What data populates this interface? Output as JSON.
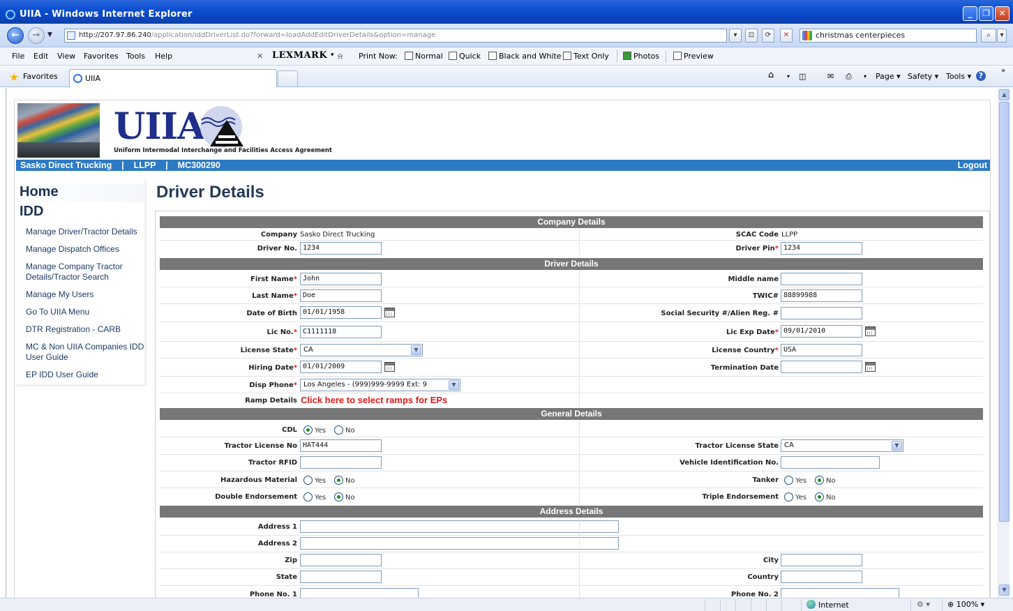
{
  "window": {
    "title": "UIIA - Windows Internet Explorer"
  },
  "address": {
    "url_host": "http://207.97.86.240",
    "url_path": "/application/iddDriverList.do?forward=loadAddEditDriverDetails&option=manage",
    "search_text": "christmas centerpieces"
  },
  "menu": [
    "File",
    "Edit",
    "View",
    "Favorites",
    "Tools",
    "Help"
  ],
  "toolbar": {
    "lexmark": "LEXMARK",
    "print_now": "Print Now:",
    "normal": "Normal",
    "quick": "Quick",
    "bw": "Black and White",
    "text_only": "Text Only",
    "photos": "Photos",
    "preview": "Preview"
  },
  "favbar": {
    "favorites": "Favorites",
    "tab_label": "UIIA",
    "page": "Page",
    "safety": "Safety",
    "tools": "Tools"
  },
  "banner": {
    "logo": "UIIA",
    "tagline": "Uniform Intermodal Interchange and Facilities Access  Agreement"
  },
  "infobar": {
    "company": "Sasko Direct Trucking",
    "sep": "|",
    "scac": "LLPP",
    "mc": "MC300290",
    "logout": "Logout"
  },
  "sidebar": {
    "home": "Home",
    "idd": "IDD",
    "links": [
      "Manage Driver/Tractor Details",
      "Manage Dispatch Offices",
      "Manage Company Tractor Details/Tractor Search",
      "Manage My Users",
      "Go To UIIA Menu",
      "DTR Registration - CARB",
      "MC & Non UIIA Companies IDD User Guide",
      "EP IDD User Guide"
    ]
  },
  "main": {
    "title": "Driver Details",
    "sections": {
      "company": "Company Details",
      "driver": "Driver Details",
      "general": "General Details",
      "address": "Address Details"
    },
    "company": {
      "company_label": "Company",
      "company_value": "Sasko Direct Trucking",
      "scac_label": "SCAC Code",
      "scac_value": "LLPP",
      "driver_no_label": "Driver No.",
      "driver_no": "1234",
      "driver_pin_label": "Driver Pin",
      "driver_pin": "1234"
    },
    "driver": {
      "first_name_label": "First Name",
      "first_name": "John",
      "middle_name_label": "Middle name",
      "middle_name": "",
      "last_name_label": "Last Name",
      "last_name": "Doe",
      "twic_label": "TWIC#",
      "twic": "88899988",
      "dob_label": "Date of Birth",
      "dob": "01/01/1958",
      "ssn_label": "Social Security #/Alien Reg. #",
      "ssn": "",
      "lic_no_label": "Lic No.",
      "lic_no": "C1111118",
      "lic_exp_label": "Lic Exp Date",
      "lic_exp": "09/01/2010",
      "lic_state_label": "License State",
      "lic_state": "CA",
      "lic_country_label": "License Country",
      "lic_country": "USA",
      "hiring_label": "Hiring Date",
      "hiring": "01/01/2009",
      "termination_label": "Termination Date",
      "termination": "",
      "disp_phone_label": "Disp Phone",
      "disp_phone": "Los Angeles - (999)999-9999 Ext: 9",
      "ramp_label": "Ramp Details",
      "ramp_link": "Click here to select ramps for EPs"
    },
    "general": {
      "cdl_label": "CDL",
      "yes": "Yes",
      "no": "No",
      "tractor_lic_label": "Tractor License No",
      "tractor_lic": "HAT444",
      "tractor_state_label": "Tractor License State",
      "tractor_state": "CA",
      "rfid_label": "Tractor RFID",
      "rfid": "",
      "vin_label": "Vehicle Identification No.",
      "vin": "",
      "hazmat_label": "Hazardous Material",
      "tanker_label": "Tanker",
      "double_label": "Double Endorsement",
      "triple_label": "Triple Endorsement"
    },
    "address": {
      "address1_label": "Address 1",
      "address2_label": "Address 2",
      "zip_label": "Zip",
      "city_label": "City",
      "state_label": "State",
      "country_label": "Country",
      "phone1_label": "Phone No. 1",
      "phone2_label": "Phone No. 2"
    }
  },
  "status": {
    "zone": "Internet",
    "zoom": "100%"
  }
}
